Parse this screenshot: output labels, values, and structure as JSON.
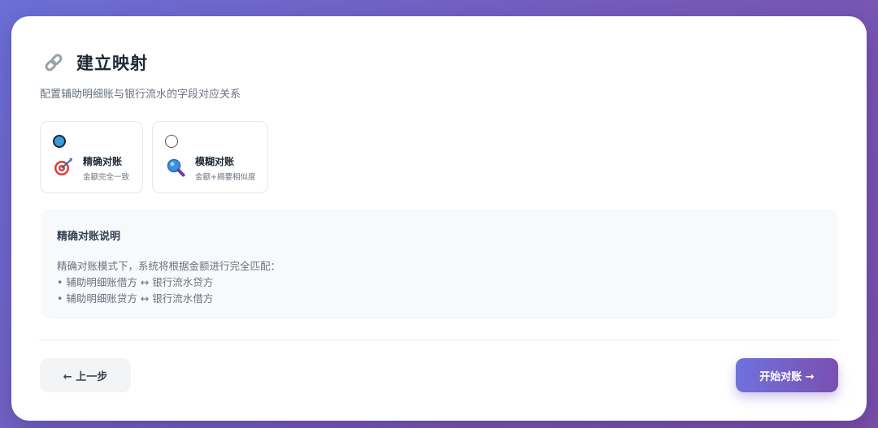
{
  "page": {
    "title": "建立映射",
    "subtitle": "配置辅助明细账与银行流水的字段对应关系"
  },
  "modes": [
    {
      "name": "精确对账",
      "desc": "金额完全一致",
      "icon": "target-icon",
      "selected": true
    },
    {
      "name": "模糊对账",
      "desc": "金额+摘要相似度",
      "icon": "magnifier-icon",
      "selected": false
    }
  ],
  "info": {
    "title": "精确对账说明",
    "lines": [
      "精确对账模式下，系统将根据金额进行完全匹配：",
      "• 辅助明细账借方 ↔ 银行流水贷方",
      "• 辅助明细账贷方 ↔ 银行流水借方"
    ]
  },
  "buttons": {
    "prev": "← 上一步",
    "start": "开始对账 →"
  },
  "colors": {
    "accent_start": "#6f72dd",
    "accent_end": "#7a4fb0",
    "radio_selected": "#3b9ad9"
  }
}
